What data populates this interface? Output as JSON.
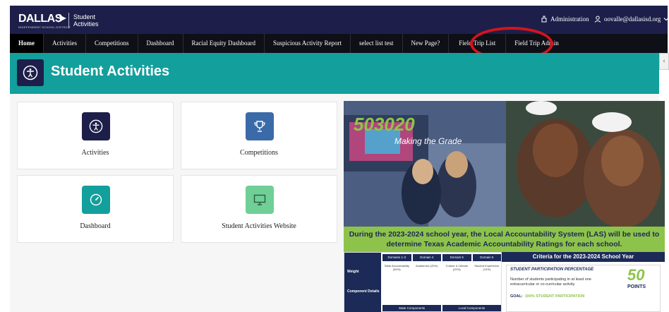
{
  "topbar": {
    "logo": "DALLAS",
    "logo_sub": "INDEPENDENT SCHOOL DISTRICT",
    "app_name_line1": "Student",
    "app_name_line2": "Activities",
    "admin_label": "Administration",
    "user_label": "oovalle@dallasisd.org"
  },
  "nav": {
    "items": [
      {
        "label": "Home"
      },
      {
        "label": "Activities"
      },
      {
        "label": "Competitions"
      },
      {
        "label": "Dashboard"
      },
      {
        "label": "Racial Equity Dashboard"
      },
      {
        "label": "Suspicious Activity Report"
      },
      {
        "label": "select list test"
      },
      {
        "label": "New Page?"
      },
      {
        "label": "Field Trip List"
      },
      {
        "label": "Field Trip Admin"
      }
    ]
  },
  "header": {
    "title": "Student Activities"
  },
  "cards": [
    {
      "label": "Activities",
      "color": "#1d1f4a"
    },
    {
      "label": "Competitions",
      "color": "#3b6aa8"
    },
    {
      "label": "Dashboard",
      "color": "#139f9c"
    },
    {
      "label": "Student Activities Website",
      "color": "#6fcf97"
    }
  ],
  "banner": {
    "logo_text": "503020",
    "tagline": "Making the Grade",
    "las_text": "During the 2023-2024 school year, the Local Accountability System (LAS) will be used to determine Texas Academic Accountability Ratings for each school.",
    "table": {
      "headers": [
        "Domains 1-3",
        "Domain 4",
        "Domain 5",
        "Domain 6"
      ],
      "row_labels": [
        "Weight",
        "Component Details"
      ],
      "weights": [
        "State Accountability (50%)",
        "Academics (20%)",
        "Culture & Climate (20%)",
        "Student Experience (10%)"
      ],
      "footer": [
        "State Components",
        "Local Components"
      ]
    },
    "criteria": {
      "title": "Criteria for the 2023-2024 School Year",
      "subtitle": "STUDENT PARTICIPATION PERCENTAGE",
      "body": "Number of students participating in at least one extracurricular or co-curricular activity",
      "goal_label": "GOAL:",
      "goal_value": "100% STUDENT PARTICIPATION",
      "points_value": "50",
      "points_label": "POINTS"
    }
  },
  "colors": {
    "navy": "#1d1f4a",
    "teal": "#139f9c",
    "green": "#8ec34b",
    "highlight": "#d4141c"
  }
}
